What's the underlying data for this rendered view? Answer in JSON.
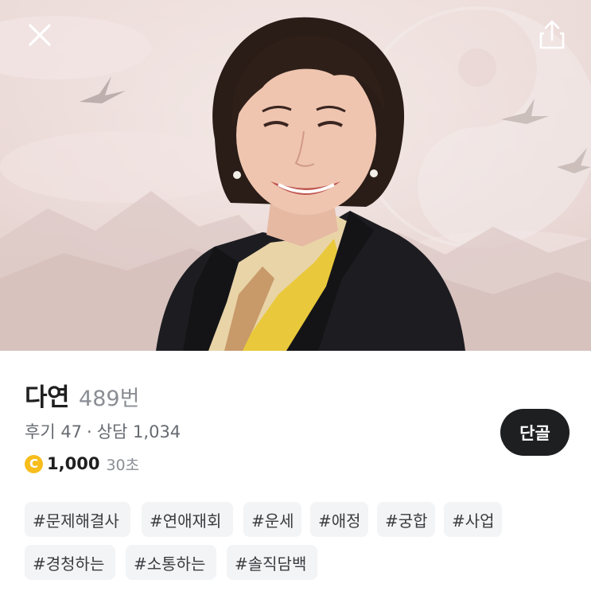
{
  "header": {
    "close_icon": "close-icon",
    "share_icon": "share-icon"
  },
  "profile": {
    "name": "다연",
    "number": "489번",
    "reviews": "후기 47",
    "separator": "·",
    "consultations": "상담 1,034",
    "coin_symbol": "C",
    "price": "1,000",
    "duration": "30초",
    "favorite_label": "단골"
  },
  "tags": [
    "#문제해결사",
    "#연애재회",
    "#운세",
    "#애정",
    "#궁합",
    "#사업",
    "#경청하는",
    "#소통하는",
    "#솔직담백"
  ],
  "colors": {
    "coin": "#f7bd1c",
    "favorite_button_bg": "#1e1f21",
    "tag_bg": "#f3f4f6"
  }
}
